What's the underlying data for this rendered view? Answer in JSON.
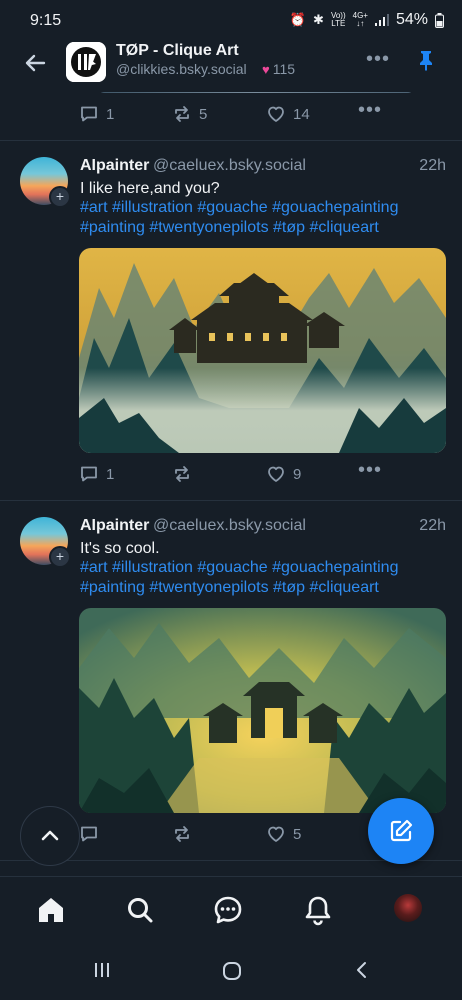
{
  "status_bar": {
    "time": "9:15",
    "network_top": "Vo))",
    "network_bottom": "LTE",
    "signal_top": "4G+",
    "battery": "54%"
  },
  "header": {
    "title": "TØP - Clique Art",
    "handle": "@clikkies.bsky.social",
    "likes": "115"
  },
  "previous_post": {
    "replies": "1",
    "reposts": "5",
    "likes": "14"
  },
  "posts": [
    {
      "author": "AIpainter",
      "handle": "@caeluex.bsky.social",
      "time": "22h",
      "text": "I like here,and you?",
      "tags_line1": "#art #illustration #gouache #gouachepainting",
      "tags_line2": "#painting #twentyonepilots #tøp #cliqueart",
      "replies": "1",
      "reposts": "",
      "likes": "9"
    },
    {
      "author": "AIpainter",
      "handle": "@caeluex.bsky.social",
      "time": "22h",
      "text": "It's so cool.",
      "tags_line1": "#art #illustration #gouache #gouachepainting",
      "tags_line2": "#painting #twentyonepilots #tøp #cliqueart",
      "replies": "",
      "reposts": "",
      "likes": "5"
    }
  ],
  "icons": {
    "back": "arrow-left-icon",
    "pin": "pin-icon",
    "reply": "comment-icon",
    "repost": "repost-icon",
    "like": "heart-icon",
    "more": "more-horizontal-icon",
    "scroll_top": "chevron-up-icon",
    "compose": "compose-icon",
    "nav": [
      "home-icon",
      "search-icon",
      "chat-icon",
      "bell-icon",
      "profile-avatar"
    ]
  },
  "colors": {
    "background": "#161e27",
    "accent": "#1d84f5",
    "hashtag": "#2f8cf0",
    "muted": "#8a98a8",
    "like_heart": "#ec4899"
  }
}
